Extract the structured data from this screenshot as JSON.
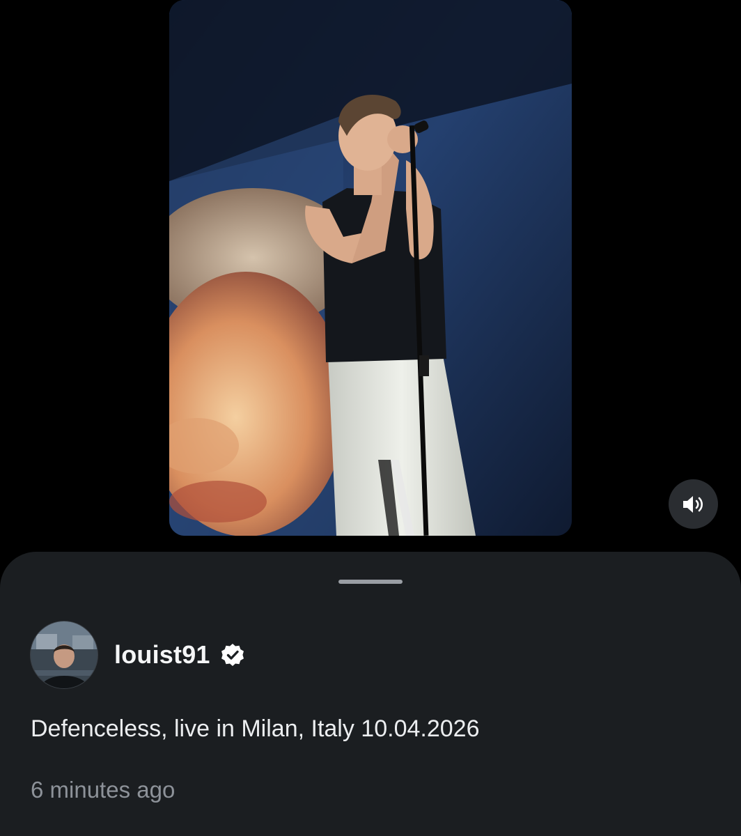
{
  "media": {
    "icon": "video-photo",
    "sound_icon": "speaker-icon"
  },
  "post": {
    "username": "louist91",
    "verified": true,
    "verified_icon": "verified-badge-icon",
    "caption": "Defenceless, live in Milan, Italy 10.04.2026",
    "timestamp": "6 minutes ago"
  },
  "colors": {
    "sheet_background": "#1b1e21",
    "primary_text": "#f5f6f7",
    "secondary_text": "#8d9299",
    "handle": "#9a9ea4"
  }
}
